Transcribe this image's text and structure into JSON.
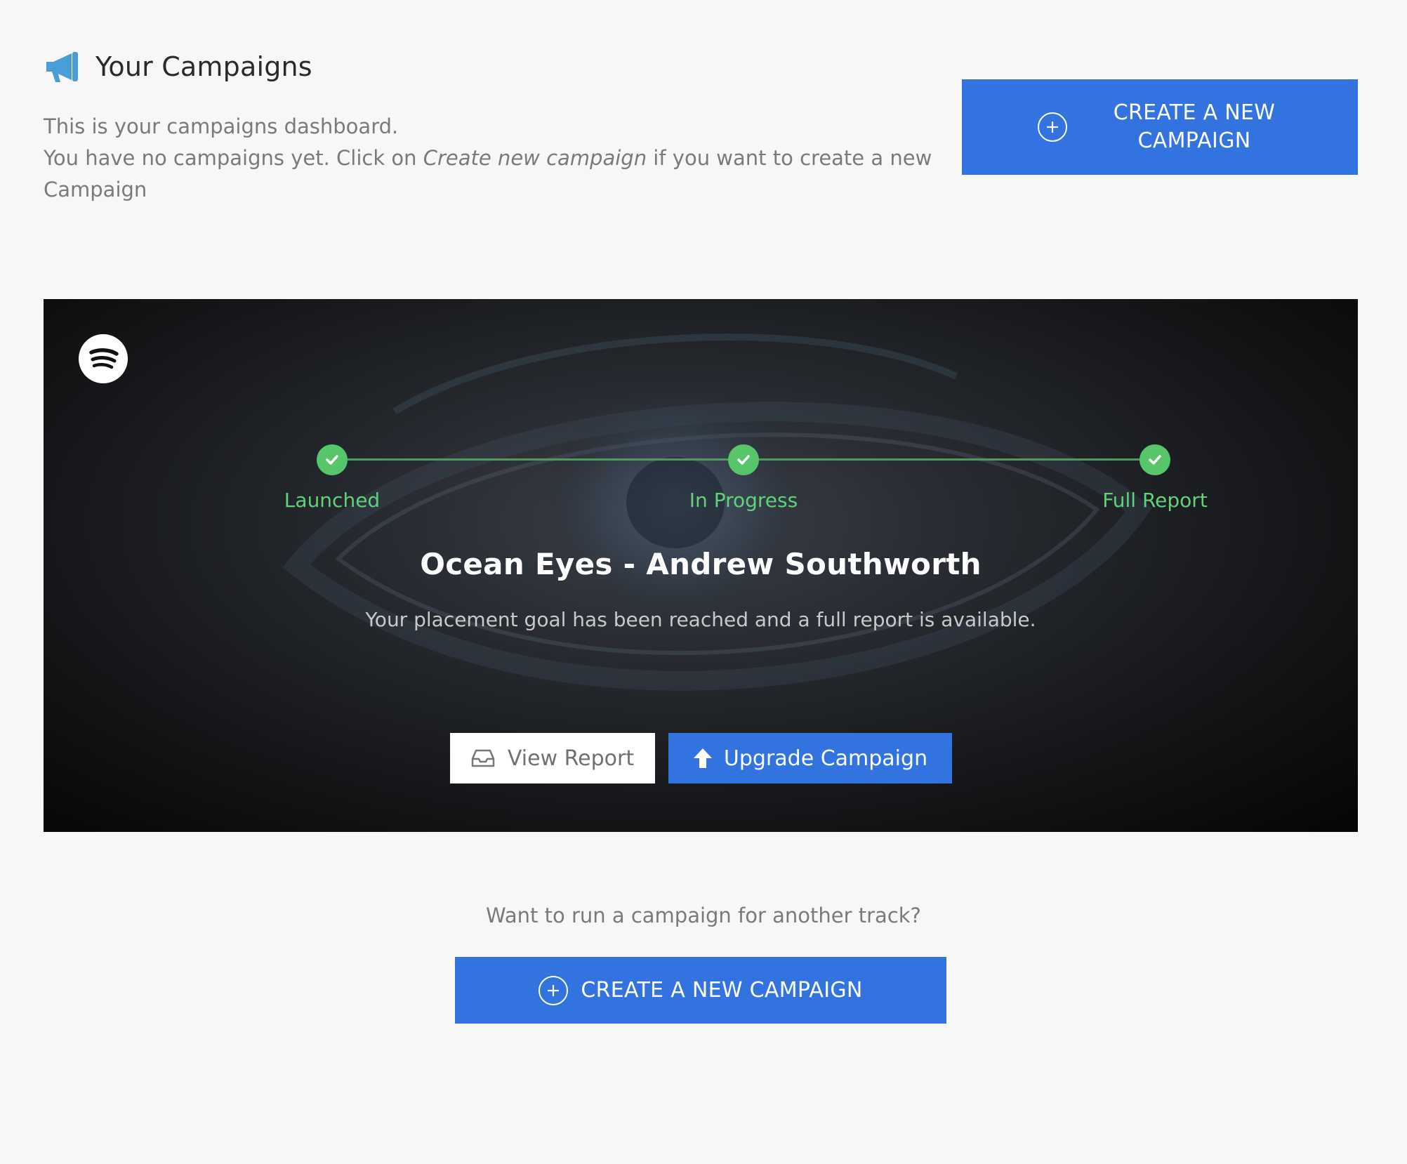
{
  "header": {
    "title": "Your Campaigns",
    "intro_line1": "This is your campaigns dashboard.",
    "intro_line2_before": "You have no campaigns yet. Click on ",
    "intro_line2_link": "Create new campaign",
    "intro_line2_after": " if you want to create a new Campaign"
  },
  "create_button_top": {
    "label": "CREATE A NEW CAMPAIGN"
  },
  "campaign_card": {
    "platform_icon": "spotify-icon",
    "steps": [
      {
        "label": "Launched",
        "status": "complete"
      },
      {
        "label": "In Progress",
        "status": "complete"
      },
      {
        "label": "Full Report",
        "status": "complete"
      }
    ],
    "title": "Ocean Eyes - Andrew Southworth",
    "subtitle": "Your placement goal has been reached and a full report is available.",
    "view_report_label": "View Report",
    "upgrade_label": "Upgrade Campaign"
  },
  "footer": {
    "question": "Want to run a campaign for another track?",
    "create_label": "CREATE A NEW CAMPAIGN"
  },
  "colors": {
    "accent_blue": "#3273e0",
    "step_green": "#57c66a",
    "megaphone_blue": "#4a9ed8"
  }
}
